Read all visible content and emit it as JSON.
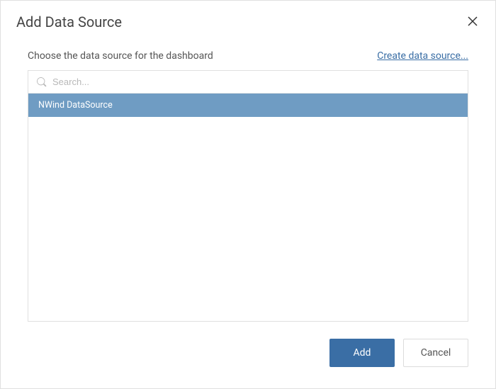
{
  "dialog": {
    "title": "Add Data Source",
    "instruction": "Choose the data source for the dashboard",
    "create_link": "Create data source...",
    "search_placeholder": "Search...",
    "items": [
      {
        "label": "NWind DataSource",
        "selected": true
      }
    ],
    "add_label": "Add",
    "cancel_label": "Cancel"
  }
}
